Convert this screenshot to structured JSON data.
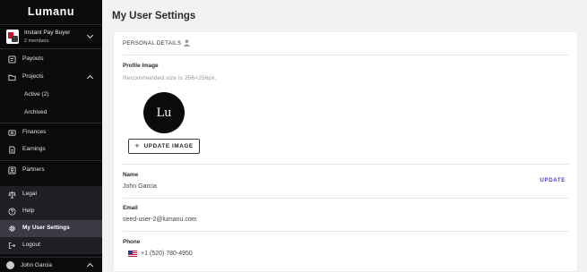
{
  "sidebar": {
    "logo": "Lumanu",
    "workspace": {
      "name": "Instant Pay Buyer",
      "members": "2 members"
    },
    "items": [
      {
        "label": "Payouts",
        "icon": "payouts-icon"
      },
      {
        "label": "Projects",
        "icon": "folder-icon"
      },
      {
        "label": "Active (2)"
      },
      {
        "label": "Archived"
      },
      {
        "label": "Finances",
        "icon": "finances-icon"
      },
      {
        "label": "Earnings",
        "icon": "earnings-icon"
      },
      {
        "label": "Partners",
        "icon": "partners-icon"
      },
      {
        "label": "Legal",
        "icon": "legal-icon"
      },
      {
        "label": "Help",
        "icon": "help-icon"
      },
      {
        "label": "My User Settings",
        "icon": "gear-icon"
      },
      {
        "label": "Logout",
        "icon": "logout-icon"
      }
    ],
    "user": {
      "name": "John Garcia"
    }
  },
  "main": {
    "title": "My User Settings",
    "section_title": "PERSONAL DETAILS",
    "profile_image": {
      "label": "Profile Image",
      "hint": "Recommended size is 256×256px.",
      "initials": "Lu",
      "button": "UPDATE IMAGE"
    },
    "name": {
      "label": "Name",
      "value": "John Garcia",
      "action": "UPDATE"
    },
    "email": {
      "label": "Email",
      "value": "seed-user-2@lumanu.com"
    },
    "phone": {
      "label": "Phone",
      "value": "+1 (520) 780-4950",
      "flag": "us-flag-icon"
    }
  },
  "colors": {
    "sidebar_bg": "#0b0b0d",
    "accent": "#4a3fbd",
    "active_bg": "#3a3b45"
  }
}
